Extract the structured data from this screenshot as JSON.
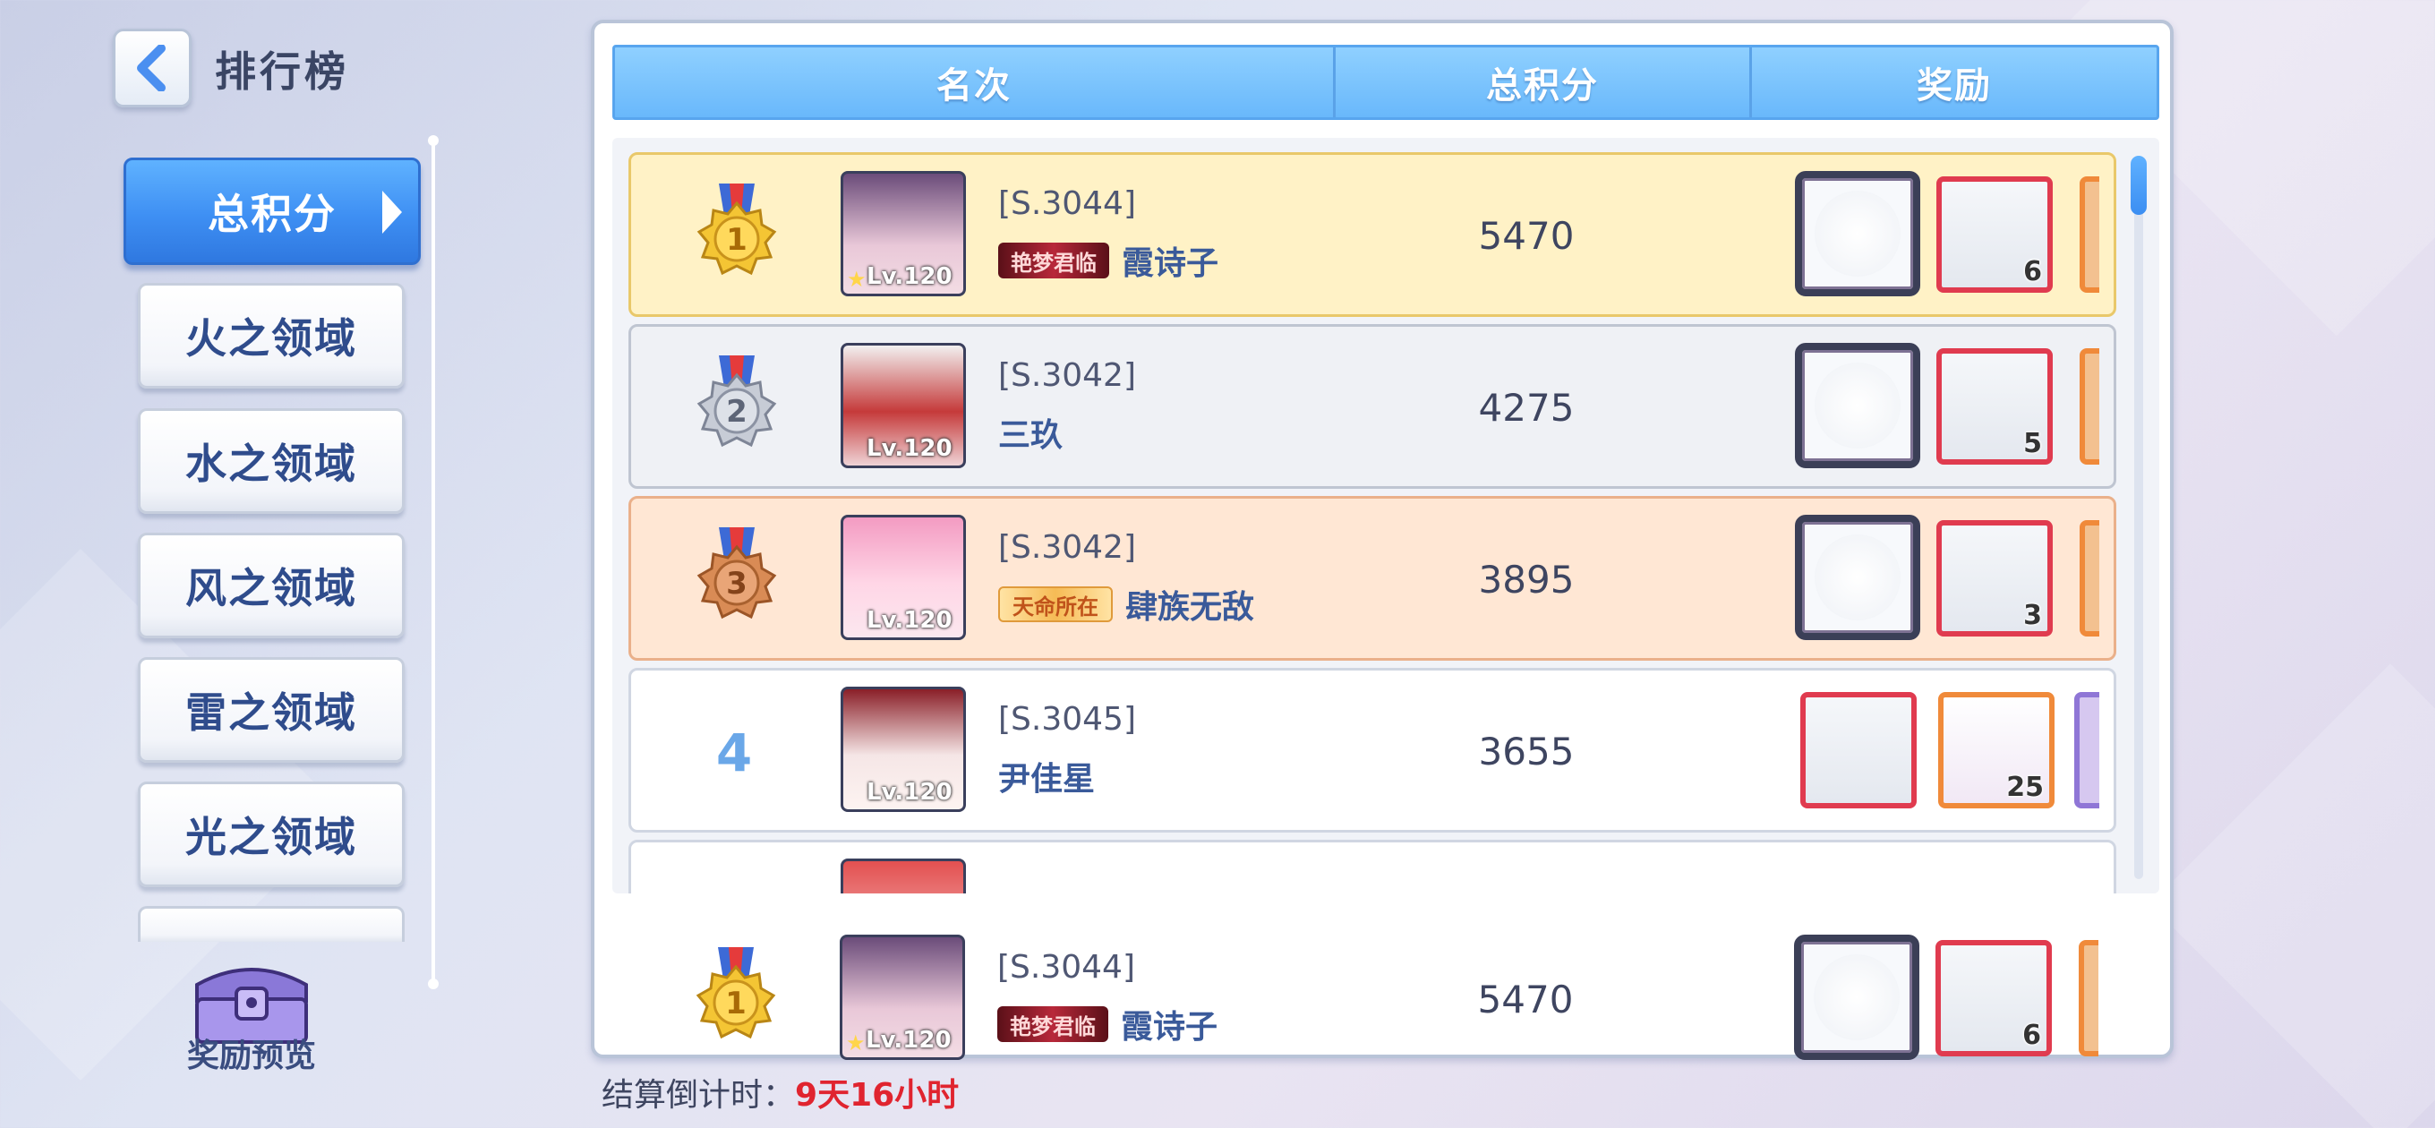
{
  "page": {
    "title": "排行榜"
  },
  "categories": [
    {
      "label": "总积分",
      "active": true
    },
    {
      "label": "火之领域",
      "active": false
    },
    {
      "label": "水之领域",
      "active": false
    },
    {
      "label": "风之领域",
      "active": false
    },
    {
      "label": "雷之领域",
      "active": false
    },
    {
      "label": "光之领域",
      "active": false
    }
  ],
  "reward_preview": {
    "label": "奖励预览"
  },
  "table": {
    "headers": {
      "rank": "名次",
      "score": "总积分",
      "reward": "奖励"
    },
    "rows": [
      {
        "rank": "1",
        "medal": "gold",
        "server": "[S.3044]",
        "name": "霞诗子",
        "title_badge": "艳梦君临",
        "level": "Lv.120",
        "score": "5470",
        "reward_qty": "6"
      },
      {
        "rank": "2",
        "medal": "silver",
        "server": "[S.3042]",
        "name": "三玖",
        "title_badge": "",
        "level": "Lv.120",
        "score": "4275",
        "reward_qty": "5"
      },
      {
        "rank": "3",
        "medal": "bronze",
        "server": "[S.3042]",
        "name": "肆族无敌",
        "title_badge": "天命所在",
        "level": "Lv.120",
        "score": "3895",
        "reward_qty": "3"
      },
      {
        "rank": "4",
        "medal": "",
        "server": "[S.3045]",
        "name": "尹佳星",
        "title_badge": "",
        "level": "Lv.120",
        "score": "3655",
        "reward_qty": "25"
      }
    ],
    "my_rank": {
      "rank": "1",
      "medal": "gold",
      "server": "[S.3044]",
      "name": "霞诗子",
      "title_badge": "艳梦君临",
      "level": "Lv.120",
      "score": "5470",
      "reward_qty": "6"
    }
  },
  "countdown": {
    "label": "结算倒计时：",
    "value": "9天16小时"
  },
  "colors": {
    "accent": "#3e8ff3",
    "header": "#7cc4fd",
    "gold": "#f4c534",
    "silver": "#b7bcc8",
    "bronze": "#d98b55",
    "countdown": "#e0242f"
  }
}
